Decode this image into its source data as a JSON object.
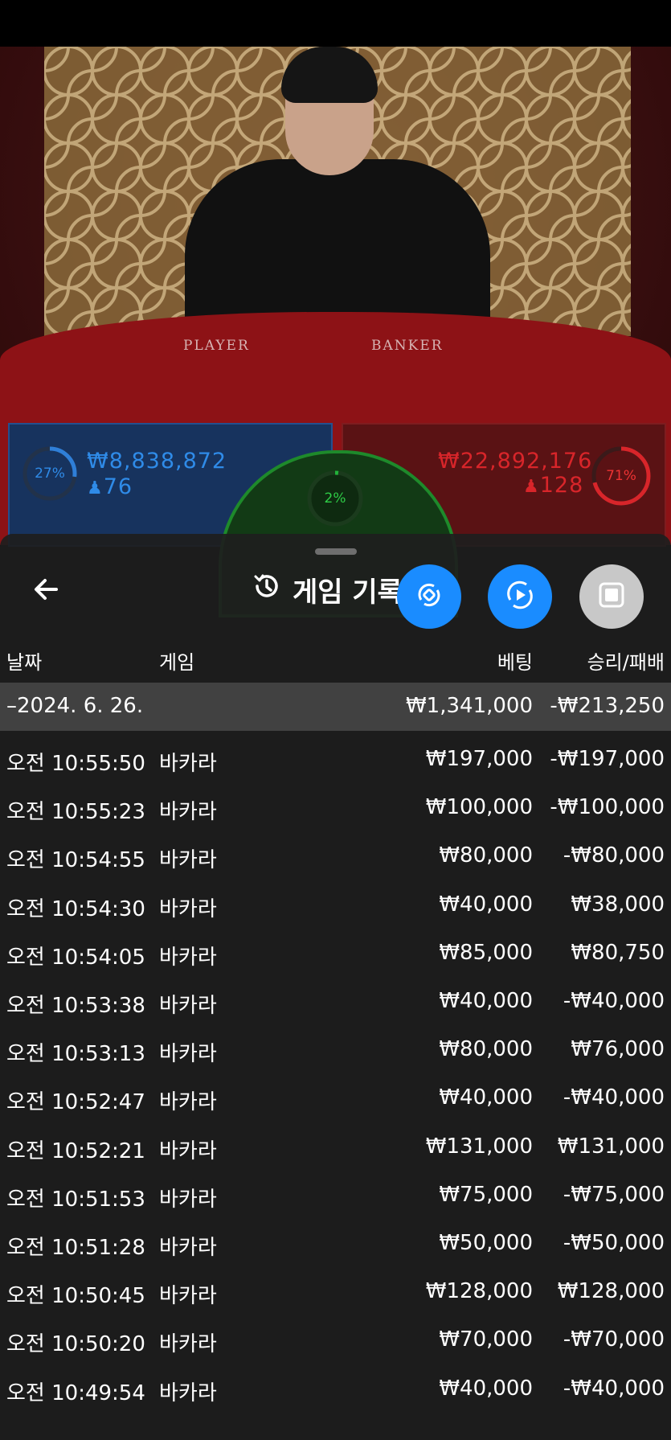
{
  "video": {
    "table_labels": {
      "player": "PLAYER",
      "banker": "BANKER"
    },
    "player_stat": {
      "percent": "27%",
      "amount": "₩8,838,872",
      "count": "76",
      "fill": 0.27
    },
    "banker_stat": {
      "percent": "71%",
      "amount": "₩22,892,176",
      "count": "128",
      "fill": 0.71
    },
    "tie_stat": {
      "percent": "2%",
      "fill": 0.02
    },
    "colors": {
      "player": "#2f7fd8",
      "banker": "#d8252a",
      "tie": "#22b33a"
    }
  },
  "panel": {
    "title": "게임 기록",
    "buttons": [
      {
        "icon": "rotate-sync-icon",
        "color": "#1a8cff"
      },
      {
        "icon": "replay-icon",
        "color": "#1a8cff"
      },
      {
        "icon": "stop-icon",
        "color": "#c8c8c8"
      }
    ],
    "columns": {
      "date": "날짜",
      "game": "게임",
      "bet": "베팅",
      "result": "승리/패배"
    },
    "summary": {
      "date": "–2024. 6. 26.",
      "bet": "₩1,341,000",
      "result": "-₩213,250"
    },
    "rows": [
      {
        "time": "오전 10:55:50",
        "game": "바카라",
        "bet": "₩197,000",
        "result": "-₩197,000"
      },
      {
        "time": "오전 10:55:23",
        "game": "바카라",
        "bet": "₩100,000",
        "result": "-₩100,000"
      },
      {
        "time": "오전 10:54:55",
        "game": "바카라",
        "bet": "₩80,000",
        "result": "-₩80,000"
      },
      {
        "time": "오전 10:54:30",
        "game": "바카라",
        "bet": "₩40,000",
        "result": "₩38,000"
      },
      {
        "time": "오전 10:54:05",
        "game": "바카라",
        "bet": "₩85,000",
        "result": "₩80,750"
      },
      {
        "time": "오전 10:53:38",
        "game": "바카라",
        "bet": "₩40,000",
        "result": "-₩40,000"
      },
      {
        "time": "오전 10:53:13",
        "game": "바카라",
        "bet": "₩80,000",
        "result": "₩76,000"
      },
      {
        "time": "오전 10:52:47",
        "game": "바카라",
        "bet": "₩40,000",
        "result": "-₩40,000"
      },
      {
        "time": "오전 10:52:21",
        "game": "바카라",
        "bet": "₩131,000",
        "result": "₩131,000"
      },
      {
        "time": "오전 10:51:53",
        "game": "바카라",
        "bet": "₩75,000",
        "result": "-₩75,000"
      },
      {
        "time": "오전 10:51:28",
        "game": "바카라",
        "bet": "₩50,000",
        "result": "-₩50,000"
      },
      {
        "time": "오전 10:50:45",
        "game": "바카라",
        "bet": "₩128,000",
        "result": "₩128,000"
      },
      {
        "time": "오전 10:50:20",
        "game": "바카라",
        "bet": "₩70,000",
        "result": "-₩70,000"
      },
      {
        "time": "오전 10:49:54",
        "game": "바카라",
        "bet": "₩40,000",
        "result": "-₩40,000"
      }
    ]
  }
}
